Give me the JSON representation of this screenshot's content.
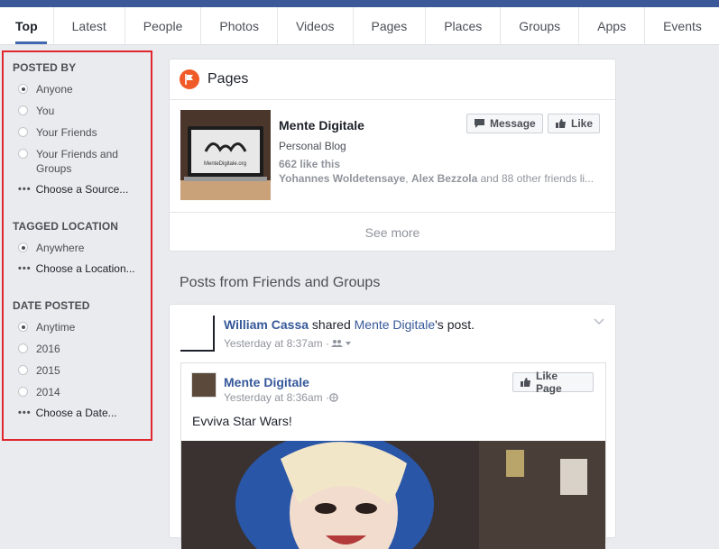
{
  "tabs": [
    "Top",
    "Latest",
    "People",
    "Photos",
    "Videos",
    "Pages",
    "Places",
    "Groups",
    "Apps",
    "Events"
  ],
  "filters": {
    "posted_by": {
      "title": "POSTED BY",
      "options": [
        "Anyone",
        "You",
        "Your Friends",
        "Your Friends and Groups"
      ],
      "choose": "Choose a Source..."
    },
    "tagged_location": {
      "title": "TAGGED LOCATION",
      "options": [
        "Anywhere"
      ],
      "choose": "Choose a Location..."
    },
    "date_posted": {
      "title": "DATE POSTED",
      "options": [
        "Anytime",
        "2016",
        "2015",
        "2014"
      ],
      "choose": "Choose a Date..."
    }
  },
  "pages_card": {
    "title": "Pages",
    "page_name": "Mente Digitale",
    "category": "Personal Blog",
    "likes": "662 like this",
    "friends_prefix": "Yohannes Woldetensaye",
    "friends_mid": ", ",
    "friends_second": "Alex Bezzola",
    "friends_suffix": " and 88 other friends li...",
    "message_label": "Message",
    "like_label": "Like",
    "see_more": "See more",
    "thumb_caption": "MenteDigitale.org"
  },
  "posts_heading": "Posts from Friends and Groups",
  "post": {
    "author": "William Cassa",
    "action": " shared ",
    "shared_link": "Mente Digitale",
    "suffix": "'s post.",
    "time": "Yesterday at 8:37am · ",
    "shared": {
      "name": "Mente Digitale",
      "time": "Yesterday at 8:36am · ",
      "like_page_label": "Like Page",
      "text": "Evviva Star Wars!"
    }
  },
  "colors": {
    "accent": "#4267b2",
    "highlight_border": "#e0262e",
    "pages_icon": "#f05a28"
  }
}
